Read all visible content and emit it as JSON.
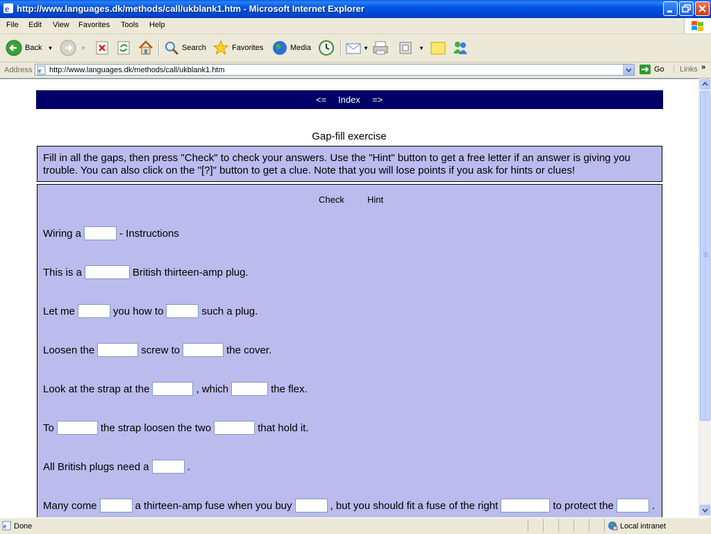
{
  "window": {
    "title": "http://www.languages.dk/methods/call/ukblank1.htm - Microsoft Internet Explorer"
  },
  "menu": [
    "File",
    "Edit",
    "View",
    "Favorites",
    "Tools",
    "Help"
  ],
  "toolbar": {
    "back": "Back",
    "search": "Search",
    "favorites": "Favorites",
    "media": "Media"
  },
  "address": {
    "label": "Address",
    "url": "http://www.languages.dk/methods/call/ukblank1.htm",
    "go": "Go",
    "links": "Links"
  },
  "page": {
    "nav": {
      "prev": "<=",
      "index": "Index",
      "next": "=>"
    },
    "title": "Gap-fill exercise",
    "instructions": "Fill in all the gaps, then press \"Check\" to check your answers. Use the \"Hint\" button to get a free letter if an answer is giving you trouble. You can also click on the \"[?]\" button to get a clue. Note that you will lose points if you ask for hints or clues!",
    "buttons": {
      "check": "Check",
      "hint": "Hint"
    },
    "lines": [
      [
        "Wiring a",
        " - Instructions"
      ],
      [
        "This is a",
        " British thirteen-amp plug."
      ],
      [
        "Let me",
        " you how to",
        " such a plug."
      ],
      [
        "Loosen the",
        " screw to",
        " the cover."
      ],
      [
        "Look at the strap at the",
        ", which",
        " the flex."
      ],
      [
        "To",
        " the strap loosen the two",
        " that hold it."
      ],
      [
        "All British plugs need a",
        "."
      ],
      [
        "Many come",
        " a thirteen-amp fuse when you buy",
        ", but you should fit a fuse of the right",
        " to protect the",
        "."
      ]
    ]
  },
  "status": {
    "text": "Done",
    "zone": "Local intranet"
  }
}
